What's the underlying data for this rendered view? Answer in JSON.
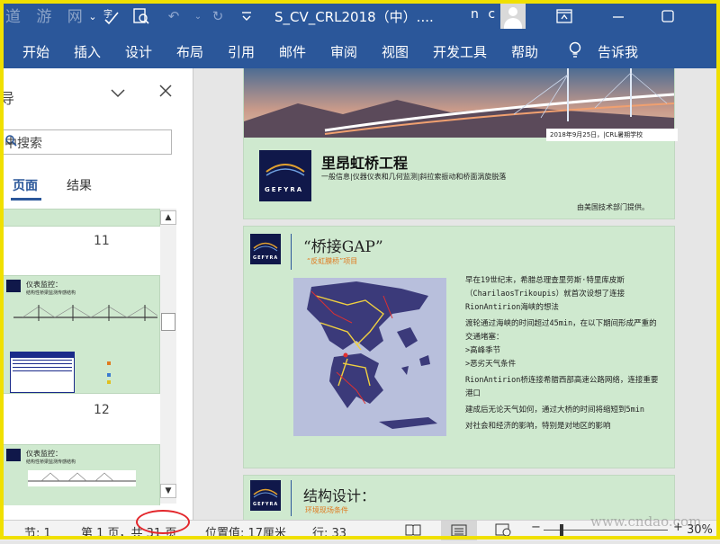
{
  "watermark_top": "道 游 网",
  "titlebar": {
    "doc_title": "S_CV_CRL2018（中）....",
    "user": "n c",
    "icons": [
      "save-icon",
      "dropdown-icon",
      "spellcheck-icon",
      "print-preview-icon",
      "undo-icon",
      "redo-icon",
      "customize-icon",
      "ribbon-display-icon",
      "minimize-icon",
      "restore-icon"
    ]
  },
  "ribbon": {
    "tabs": [
      "开始",
      "插入",
      "设计",
      "布局",
      "引用",
      "邮件",
      "审阅",
      "视图",
      "开发工具",
      "帮助"
    ],
    "tell_me": "告诉我"
  },
  "nav": {
    "title_fragment": "导",
    "search_placeholder": "中搜索",
    "tab_pages": "页面",
    "tab_results": "结果",
    "page_numbers": [
      "11",
      "12"
    ],
    "thumb11_title": "仪表监控：",
    "thumb11_subtitle": "结构性桥梁监测传感结构",
    "thumb12_title": "仪表监控：",
    "thumb12_subtitle": "结构性桥梁监测传感结构"
  },
  "page1": {
    "date_line": "2018年9月25日，|CRL暑期学校",
    "title": "里昂虹桥工程",
    "subtitle": "一般信息|仪器仪表和几何监测|斜拉索振动和桥面涡旋脱落",
    "credit": "由美国技术部门提供。",
    "logo_text": "GEFYRA"
  },
  "page2": {
    "heading": "“桥接GAP”",
    "subheading": "“反虹膜桥”项目",
    "logo_text": "GEFYRA",
    "paragraphs": [
      "早在19世纪末，希腊总理查里劳斯·特里库皮斯（CharilaosTrikoupis）就首次设想了连接RionAntirion海峡的想法",
      "渡轮通过海峡的时间超过45min，在以下期间形成严重的交通堵塞：",
      ">高峰季节",
      ">恶劣天气条件",
      "RionAntirion桥连接希腊西部高速公路网络，连接重要港口",
      "建成后无论天气如何，通过大桥的时间将缩短到5min",
      "对社会和经济的影响，特别是对地区的影响"
    ]
  },
  "page3": {
    "heading": "结构设计：",
    "subheading": "环境现场条件",
    "logo_text": "GEFYRA"
  },
  "status": {
    "section": "节: 1",
    "page": "第 1 页，共 31 页",
    "position": "位置值: 17厘米",
    "line": "行: 33",
    "zoom": "30%",
    "watermark": "www.cndao.com"
  },
  "colors": {
    "word_blue": "#2b579a",
    "page_green": "#cfe9cf",
    "annotation_red": "#e3262b",
    "accent_orange": "#e07a1f"
  }
}
